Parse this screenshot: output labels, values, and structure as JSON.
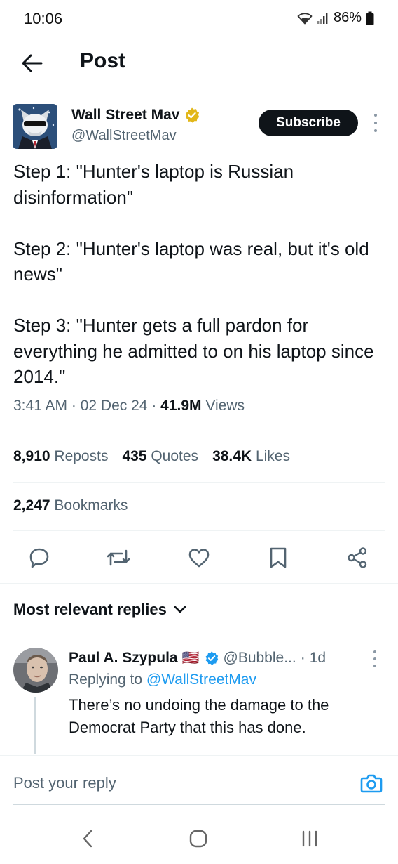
{
  "status_bar": {
    "time": "10:06",
    "battery": "86%"
  },
  "header": {
    "title": "Post"
  },
  "author": {
    "name": "Wall Street Mav",
    "handle": "@WallStreetMav",
    "subscribe_label": "Subscribe",
    "verified_color": "#e2b719"
  },
  "post": {
    "text": "Step 1: \"Hunter's laptop is Russian disinformation\"\n\nStep 2: \"Hunter's laptop was real, but it's old news\"\n\nStep 3: \"Hunter gets a full pardon for everything he admitted to on his laptop since 2014.\"",
    "time": "3:41 AM",
    "date": "02 Dec 24",
    "views_count": "41.9M",
    "views_label": "Views"
  },
  "stats": {
    "reposts_count": "8,910",
    "reposts_label": "Reposts",
    "quotes_count": "435",
    "quotes_label": "Quotes",
    "likes_count": "38.4K",
    "likes_label": "Likes",
    "bookmarks_count": "2,247",
    "bookmarks_label": "Bookmarks"
  },
  "actions": [
    "reply-icon",
    "repost-icon",
    "like-icon",
    "bookmark-icon",
    "share-icon"
  ],
  "replies_filter": {
    "label": "Most relevant replies"
  },
  "reply": {
    "name": "Paul A. Szypula",
    "flag": "🇺🇸",
    "handle": "@Bubble...",
    "separator": "·",
    "time": "1d",
    "replying_prefix": "Replying to",
    "replying_to": "@WallStreetMav",
    "text": "There’s no undoing the damage to the Democrat Party that this has done.",
    "verified_color": "#1d9bf0"
  },
  "composer": {
    "placeholder": "Post your reply"
  },
  "colors": {
    "link": "#1d9bf0",
    "secondary_text": "#536471",
    "primary_text": "#0f1419"
  }
}
